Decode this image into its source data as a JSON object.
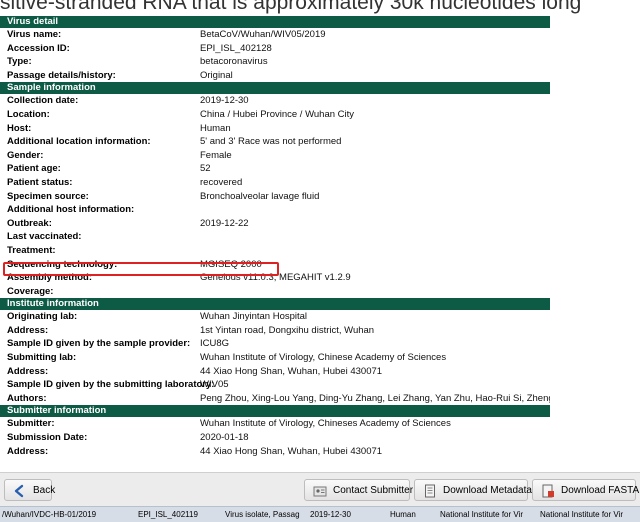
{
  "top_fragment": "sitive-stranded RNA that is approximately 30k nucleotides long",
  "sections": [
    {
      "title": "Virus detail",
      "rows": [
        {
          "key": "Virus name:",
          "value": "BetaCoV/Wuhan/WIV05/2019"
        },
        {
          "key": "Accession ID:",
          "value": "EPI_ISL_402128"
        },
        {
          "key": "Type:",
          "value": "betacoronavirus"
        },
        {
          "key": "Passage details/history:",
          "value": "Original"
        }
      ]
    },
    {
      "title": "Sample information",
      "rows": [
        {
          "key": "Collection date:",
          "value": "2019-12-30"
        },
        {
          "key": "Location:",
          "value": "China / Hubei Province / Wuhan City"
        },
        {
          "key": "Host:",
          "value": "Human"
        },
        {
          "key": "Additional location information:",
          "value": "5' and 3' Race was not performed"
        },
        {
          "key": "Gender:",
          "value": "Female"
        },
        {
          "key": "Patient age:",
          "value": "52"
        },
        {
          "key": "Patient status:",
          "value": "recovered"
        },
        {
          "key": "Specimen source:",
          "value": "Bronchoalveolar lavage fluid"
        },
        {
          "key": "Additional host information:",
          "value": ""
        },
        {
          "key": "Outbreak:",
          "value": "2019-12-22"
        },
        {
          "key": "Last vaccinated:",
          "value": ""
        },
        {
          "key": "Treatment:",
          "value": ""
        },
        {
          "key": "Sequencing technology:",
          "value": "MGISEQ 2000"
        },
        {
          "key": "Assembly method:",
          "value": "Geneious v11.0.3, MEGAHIT v1.2.9"
        },
        {
          "key": "Coverage:",
          "value": ""
        }
      ]
    },
    {
      "title": "Institute information",
      "rows": [
        {
          "key": "Originating lab:",
          "value": "Wuhan Jinyintan Hospital"
        },
        {
          "key": "Address:",
          "value": "1st Yintan road, Dongxihu district, Wuhan"
        },
        {
          "key": "Sample ID given by the sample provider:",
          "value": "ICU8G"
        },
        {
          "key": "Submitting lab:",
          "value": "Wuhan Institute of Virology, Chinese Academy of Sciences"
        },
        {
          "key": "Address:",
          "value": "44 Xiao Hong Shan, Wuhan, Hubei 430071"
        },
        {
          "key": "Sample ID given by the submitting laboratory:",
          "value": "WIV05"
        },
        {
          "key": "Authors:",
          "value": "Peng Zhou, Xing-Lou Yang, Ding-Yu Zhang, Lei Zhang, Yan Zhu, Hao-Rui Si, Zhengli Shi"
        }
      ]
    },
    {
      "title": "Submitter information",
      "rows": [
        {
          "key": "Submitter:",
          "value": "Wuhan Institute of Virology, Chineses Academy of Sciences"
        },
        {
          "key": "Submission Date:",
          "value": "2020-01-18"
        },
        {
          "key": "Address:",
          "value": "44 Xiao Hong Shan, Wuhan, Hubei 430071"
        }
      ]
    }
  ],
  "buttons": {
    "back": "Back",
    "contact": "Contact Submitter",
    "metadata": "Download Metadata",
    "fasta": "Download FASTA"
  },
  "status_row": [
    "/Wuhan/IVDC-HB-01/2019",
    "EPI_ISL_402119",
    "Virus isolate, Passag",
    "2019-12-30",
    "Human",
    "National Institute for Vir",
    "National Institute for Vir"
  ],
  "colors": {
    "section_header": "#0d5a45",
    "highlight": "#dd2222"
  }
}
